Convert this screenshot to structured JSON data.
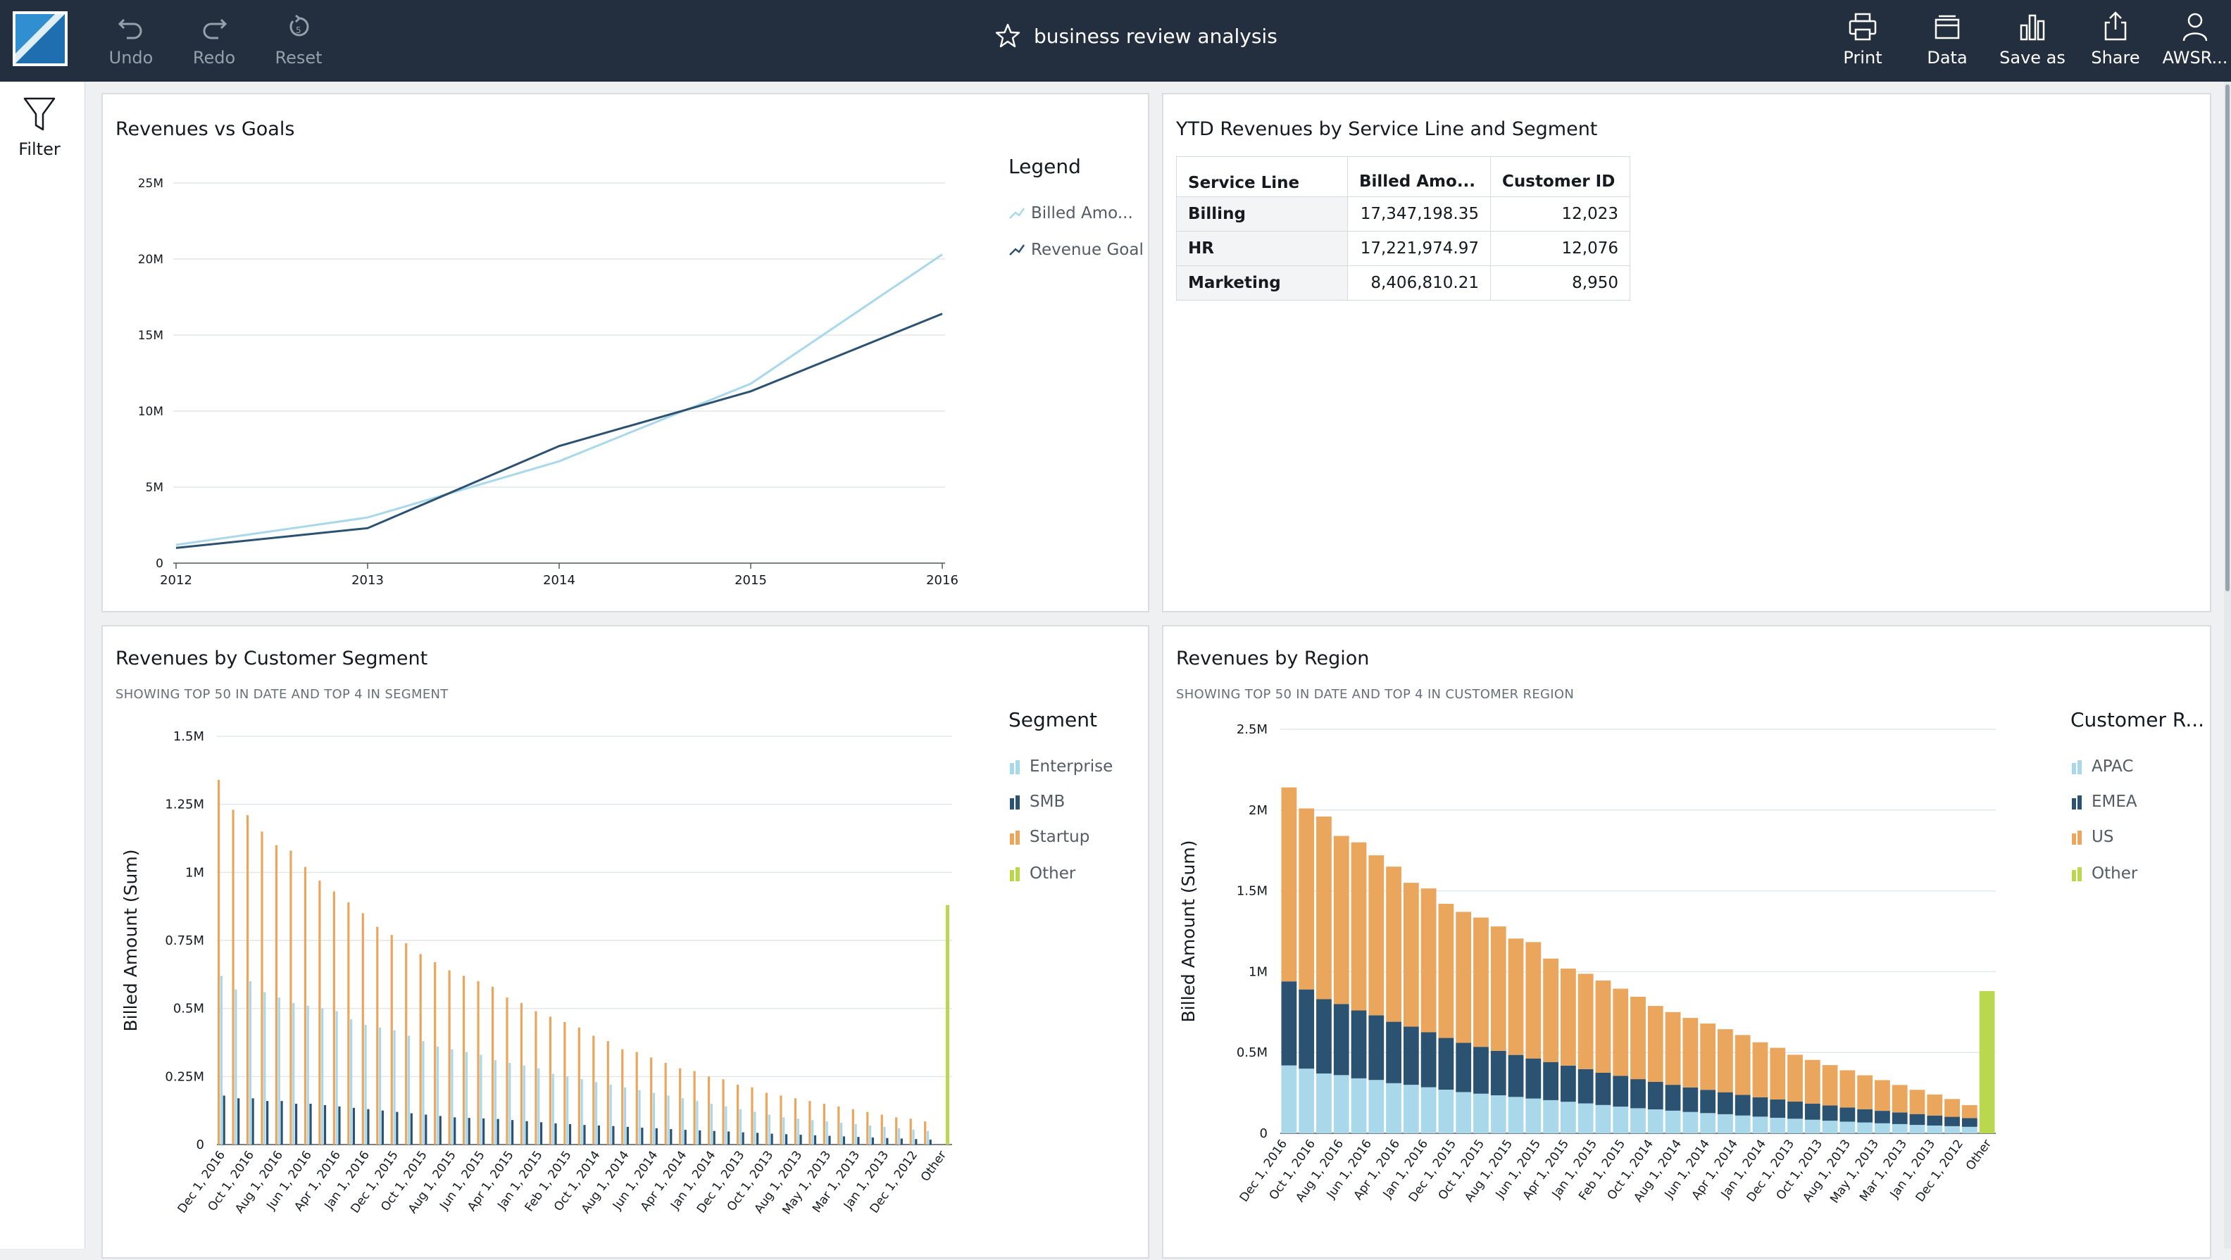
{
  "toolbar": {
    "undo": "Undo",
    "redo": "Redo",
    "reset": "Reset",
    "title": "business review analysis",
    "print": "Print",
    "data": "Data",
    "save_as": "Save as",
    "share": "Share",
    "account": "AWSR..."
  },
  "sidebar": {
    "filter": "Filter"
  },
  "colors": {
    "topbar": "#232f3e",
    "light_blue": "#a8d8ea",
    "dark_blue": "#2c5272",
    "orange": "#eaa65c",
    "green": "#b9d84d"
  },
  "panels": {
    "rev_goals": {
      "title": "Revenues vs Goals",
      "legend_title": "Legend",
      "legend": [
        "Billed Amo...",
        "Revenue Goal"
      ]
    },
    "ytd": {
      "title": "YTD Revenues by Service Line and Segment",
      "columns": [
        "Service Line",
        "Billed Amo...",
        "Customer ID"
      ],
      "rows": [
        [
          "Billing",
          "17,347,198.35",
          "12,023"
        ],
        [
          "HR",
          "17,221,974.97",
          "12,076"
        ],
        [
          "Marketing",
          "8,406,810.21",
          "8,950"
        ]
      ]
    },
    "segment": {
      "title": "Revenues by Customer Segment",
      "subtitle": "SHOWING TOP 50 IN DATE AND TOP 4 IN SEGMENT",
      "legend_title": "Segment",
      "legend": [
        "Enterprise",
        "SMB",
        "Startup",
        "Other"
      ]
    },
    "region": {
      "title": "Revenues by Region",
      "subtitle": "SHOWING TOP 50 IN DATE AND TOP 4 IN CUSTOMER REGION",
      "legend_title": "Customer R...",
      "legend": [
        "APAC",
        "EMEA",
        "US",
        "Other"
      ]
    }
  },
  "chart_data": [
    {
      "type": "line",
      "title": "Revenues vs Goals",
      "x": [
        "2012",
        "2013",
        "2014",
        "2015",
        "2016"
      ],
      "y_ticks": [
        "0",
        "5M",
        "10M",
        "15M",
        "20M",
        "25M"
      ],
      "ylim": [
        0,
        25000000
      ],
      "grid": true,
      "legend_position": "right",
      "series": [
        {
          "name": "Billed Amo...",
          "color": "#a8d8ea",
          "values": [
            1200000,
            3000000,
            6700000,
            11800000,
            20300000
          ]
        },
        {
          "name": "Revenue Goal",
          "color": "#2c5272",
          "values": [
            1000000,
            2300000,
            7700000,
            11300000,
            16400000
          ]
        }
      ]
    },
    {
      "type": "bar",
      "title": "Revenues by Customer Segment",
      "ylabel": "Billed Amount (Sum)",
      "y_ticks": [
        "0",
        "0.25M",
        "0.5M",
        "0.75M",
        "1M",
        "1.25M",
        "1.5M"
      ],
      "ylim": [
        0,
        1500000
      ],
      "grid": true,
      "legend_position": "right",
      "x_tick_labels": [
        "Dec 1, 2016",
        "Oct 1, 2016",
        "Aug 1, 2016",
        "Jun 1, 2016",
        "Apr 1, 2016",
        "Jan 1, 2016",
        "Dec 1, 2015",
        "Oct 1, 2015",
        "Aug 1, 2015",
        "Jun 1, 2015",
        "Apr 1, 2015",
        "Jan 1, 2015",
        "Feb 1, 2015",
        "Oct 1, 2014",
        "Aug 1, 2014",
        "Jun 1, 2014",
        "Apr 1, 2014",
        "Jan 1, 2014",
        "Dec 1, 2013",
        "Oct 1, 2013",
        "Aug 1, 2013",
        "May 1, 2013",
        "Mar 1, 2013",
        "Jan 1, 2013",
        "Dec 1, 2012",
        "Other"
      ],
      "group_count": 51,
      "series": [
        {
          "name": "Enterprise",
          "color": "#a8d8ea",
          "values": [
            620000,
            570000,
            600000,
            560000,
            540000,
            520000,
            510000,
            500000,
            490000,
            460000,
            440000,
            430000,
            420000,
            400000,
            380000,
            360000,
            350000,
            340000,
            330000,
            310000,
            300000,
            290000,
            280000,
            260000,
            250000,
            240000,
            230000,
            220000,
            210000,
            200000,
            190000,
            180000,
            170000,
            160000,
            150000,
            140000,
            130000,
            120000,
            110000,
            100000,
            95000,
            90000,
            85000,
            80000,
            75000,
            70000,
            65000,
            60000,
            55000,
            50000,
            0
          ]
        },
        {
          "name": "SMB",
          "color": "#2c5272",
          "values": [
            180000,
            170000,
            170000,
            160000,
            160000,
            150000,
            150000,
            145000,
            140000,
            135000,
            130000,
            125000,
            120000,
            115000,
            110000,
            105000,
            100000,
            98000,
            96000,
            94000,
            90000,
            86000,
            82000,
            78000,
            75000,
            72000,
            70000,
            68000,
            65000,
            62000,
            60000,
            57000,
            54000,
            52000,
            50000,
            48000,
            45000,
            43000,
            40000,
            38000,
            36000,
            34000,
            32000,
            30000,
            28000,
            26000,
            24000,
            22000,
            20000,
            18000,
            0
          ]
        },
        {
          "name": "Startup",
          "color": "#eaa65c",
          "values": [
            1340000,
            1230000,
            1210000,
            1150000,
            1100000,
            1080000,
            1020000,
            970000,
            930000,
            890000,
            850000,
            800000,
            770000,
            740000,
            700000,
            670000,
            640000,
            620000,
            600000,
            580000,
            540000,
            520000,
            490000,
            470000,
            450000,
            430000,
            400000,
            380000,
            350000,
            340000,
            320000,
            300000,
            280000,
            270000,
            250000,
            240000,
            220000,
            210000,
            190000,
            180000,
            170000,
            160000,
            150000,
            140000,
            130000,
            120000,
            110000,
            100000,
            95000,
            85000,
            0
          ]
        },
        {
          "name": "Other",
          "color": "#b9d84d",
          "values": [
            0,
            0,
            0,
            0,
            0,
            0,
            0,
            0,
            0,
            0,
            0,
            0,
            0,
            0,
            0,
            0,
            0,
            0,
            0,
            0,
            0,
            0,
            0,
            0,
            0,
            0,
            0,
            0,
            0,
            0,
            0,
            0,
            0,
            0,
            0,
            0,
            0,
            0,
            0,
            0,
            0,
            0,
            0,
            0,
            0,
            0,
            0,
            0,
            0,
            0,
            880000
          ]
        }
      ]
    },
    {
      "type": "bar",
      "title": "Revenues by Region",
      "ylabel": "Billed Amount (Sum)",
      "y_ticks": [
        "0",
        "0.5M",
        "1M",
        "1.5M",
        "2M",
        "2.5M"
      ],
      "ylim": [
        0,
        2500000
      ],
      "grid": true,
      "stacked": true,
      "legend_position": "right",
      "x_tick_labels": [
        "Dec 1, 2016",
        "Oct 1, 2016",
        "Aug 1, 2016",
        "Jun 1, 2016",
        "Apr 1, 2016",
        "Jan 1, 2016",
        "Dec 1, 2015",
        "Oct 1, 2015",
        "Aug 1, 2015",
        "Jun 1, 2015",
        "Apr 1, 2015",
        "Jan 1, 2015",
        "Feb 1, 2015",
        "Oct 1, 2014",
        "Aug 1, 2014",
        "Jun 1, 2014",
        "Apr 1, 2014",
        "Jan 1, 2014",
        "Dec 1, 2013",
        "Oct 1, 2013",
        "Aug 1, 2013",
        "May 1, 2013",
        "Mar 1, 2013",
        "Jan 1, 2013",
        "Dec 1, 2012",
        "Other"
      ],
      "series": [
        {
          "name": "APAC",
          "color": "#a8d8ea",
          "values": [
            420000,
            400000,
            370000,
            360000,
            340000,
            330000,
            310000,
            300000,
            285000,
            270000,
            255000,
            245000,
            235000,
            225000,
            215000,
            205000,
            195000,
            185000,
            175000,
            165000,
            155000,
            148000,
            140000,
            132000,
            125000,
            118000,
            110000,
            103000,
            96000,
            90000,
            84000,
            78000,
            72000,
            67000,
            62000,
            57000,
            52000,
            48000,
            44000,
            40000,
            0
          ]
        },
        {
          "name": "EMEA",
          "color": "#2c5272",
          "values": [
            520000,
            490000,
            460000,
            440000,
            420000,
            400000,
            380000,
            360000,
            340000,
            320000,
            305000,
            290000,
            275000,
            260000,
            248000,
            236000,
            224000,
            212000,
            200000,
            190000,
            180000,
            170000,
            160000,
            152000,
            144000,
            136000,
            128000,
            120000,
            113000,
            106000,
            100000,
            94000,
            88000,
            82000,
            77000,
            72000,
            67000,
            62000,
            58000,
            54000,
            0
          ]
        },
        {
          "name": "US",
          "color": "#eaa65c",
          "values": [
            1200000,
            1120000,
            1130000,
            1040000,
            1040000,
            990000,
            960000,
            890000,
            890000,
            830000,
            810000,
            800000,
            770000,
            720000,
            720000,
            640000,
            600000,
            590000,
            570000,
            540000,
            510000,
            470000,
            450000,
            430000,
            410000,
            390000,
            370000,
            340000,
            320000,
            290000,
            270000,
            250000,
            230000,
            210000,
            190000,
            170000,
            150000,
            130000,
            110000,
            80000,
            0
          ]
        },
        {
          "name": "Other",
          "color": "#b9d84d",
          "values": [
            0,
            0,
            0,
            0,
            0,
            0,
            0,
            0,
            0,
            0,
            0,
            0,
            0,
            0,
            0,
            0,
            0,
            0,
            0,
            0,
            0,
            0,
            0,
            0,
            0,
            0,
            0,
            0,
            0,
            0,
            0,
            0,
            0,
            0,
            0,
            0,
            0,
            0,
            0,
            0,
            880000
          ]
        }
      ]
    }
  ]
}
